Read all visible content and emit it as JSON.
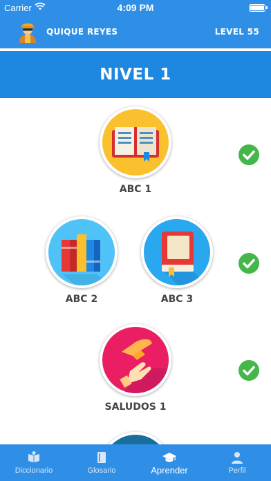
{
  "status_bar": {
    "carrier": "Carrier",
    "time": "4:09 PM"
  },
  "header": {
    "user_name": "QUIQUE REYES",
    "level_label": "LEVEL 55"
  },
  "banner": {
    "title": "NIVEL 1"
  },
  "lessons": [
    {
      "label": "ABC 1",
      "icon": "open-book-icon",
      "completed": true
    },
    {
      "label": "ABC 2",
      "icon": "books-icon",
      "completed": true
    },
    {
      "label": "ABC 3",
      "icon": "closed-book-icon",
      "completed": true
    },
    {
      "label": "SALUDOS 1",
      "icon": "handshake-icon",
      "completed": true
    }
  ],
  "tabs": [
    {
      "label": "Diccionario",
      "icon": "dictionary-icon",
      "active": false
    },
    {
      "label": "Glosario",
      "icon": "glossary-icon",
      "active": false
    },
    {
      "label": "Aprender",
      "icon": "graduation-cap-icon",
      "active": true
    },
    {
      "label": "Perfil",
      "icon": "profile-icon",
      "active": false
    }
  ],
  "colors": {
    "primary_blue": "#2f8fe6",
    "banner_blue": "#1e87e0",
    "check_green": "#45b649",
    "abc1_bg": "#fbc02d",
    "abc2_bg": "#4fc3f7",
    "abc3_bg": "#29a8f0",
    "saludos_bg": "#e91e63"
  }
}
